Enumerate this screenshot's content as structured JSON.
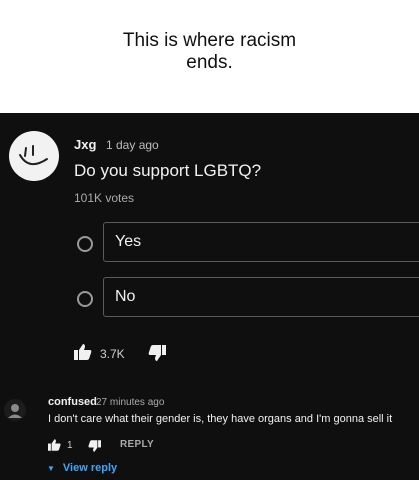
{
  "caption": {
    "line1": "This is where racism",
    "line2": "ends."
  },
  "comment": {
    "author": "Jxg",
    "time": "1 day ago",
    "question": "Do you support LGBTQ?",
    "votes": "101K votes",
    "options": [
      {
        "label": "Yes"
      },
      {
        "label": "No"
      }
    ],
    "likes": "3.7K"
  },
  "reply": {
    "author": "confused",
    "time": "27 minutes ago",
    "text": "I don't care what their gender is, they have organs and I'm gonna sell it",
    "likes": "1",
    "reply_label": "REPLY",
    "view_reply": "View reply"
  },
  "colors": {
    "background": "#0f0f0f",
    "link": "#3ea6ff",
    "text": "#f1f1f1"
  }
}
